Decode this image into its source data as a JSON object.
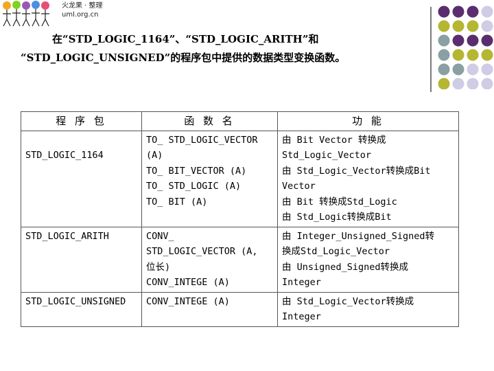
{
  "logo": {
    "text_line1": "火龙果 · 整理",
    "text_line2": "uml.org.cn"
  },
  "title": {
    "line1": "在“STD_LOGIC_1164”、“STD_LOGIC_ARITH”和",
    "line2": "“STD_LOGIC_UNSIGNED”的程序包中提供的数据类型变换函数。"
  },
  "table": {
    "headers": [
      "程 序 包",
      "函 数 名",
      "功 能"
    ],
    "rows": [
      {
        "package": "\nSTD_LOGIC_1164",
        "functions": "TO_ STD_LOGIC_VECTOR\n(A)\nTO_ BIT_VECTOR (A)\nTO_ STD_LOGIC (A)\nTO_ BIT (A)",
        "effect": "由 Bit Vector 转换成\nStd_Logic_Vector\n由 Std_Logic_Vector转换成Bit\nVector\n由 Bit 转换成Std_Logic\n由 Std_Logic转换成Bit"
      },
      {
        "package": "STD_LOGIC_ARITH",
        "functions": "CONV_\nSTD_LOGIC_VECTOR (A,\n位长)\nCONV_INTEGE (A)",
        "effect": "由 Integer_Unsigned_Signed转\n换成Std_Logic_Vector\n由 Unsigned_Signed转换成\nInteger"
      },
      {
        "package": "STD_LOGIC_UNSIGNED",
        "functions": "CONV_INTEGE (A)",
        "effect": "由 Std_Logic_Vector转换成\nInteger"
      }
    ]
  },
  "colors": {
    "purple": "#5a2e6e",
    "olive": "#b5b632",
    "teal": "#8aa0a3",
    "lavender": "#cfcce6"
  }
}
